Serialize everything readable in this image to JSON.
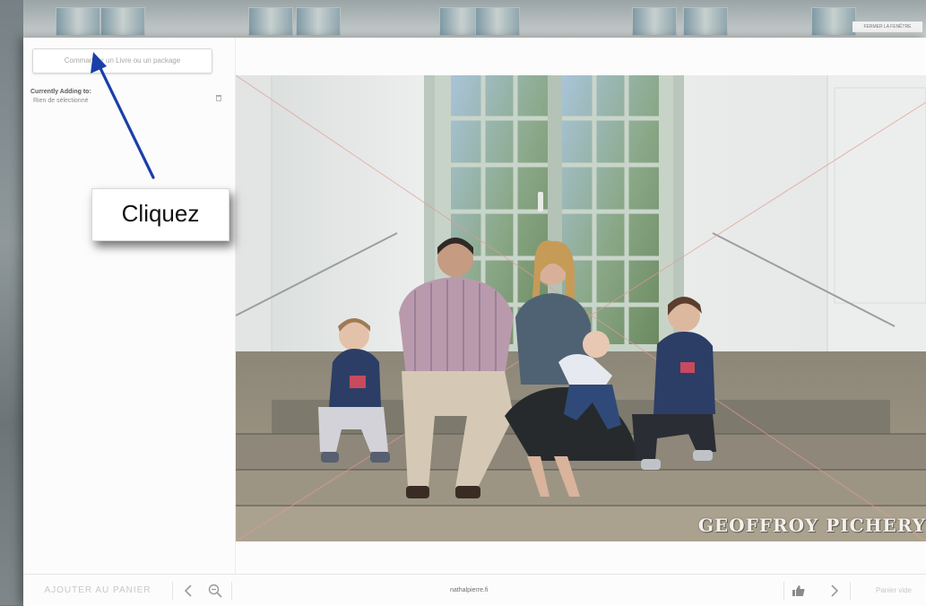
{
  "background": {
    "top_label": "FERMER LA FENÊTRE"
  },
  "sidebar": {
    "order_button_label": "Commander un Livre ou un package",
    "currently_adding_title": "Currently Adding to:",
    "currently_adding_value": "Rien de sélectionné",
    "clear_icon": "trash-icon"
  },
  "photo": {
    "watermark": "GEOFFROY PICHERY",
    "subject": "Family of five seated on stone steps in front of a white house with a green French door"
  },
  "bottom_bar": {
    "add_to_cart_label": "AJOUTER AU PANIER",
    "prev_icon": "chevron-left-icon",
    "zoom_icon": "zoom-out-icon",
    "filename": "nathalpierre.fi",
    "like_icon": "thumbs-up-icon",
    "next_icon": "chevron-right-icon",
    "cart_status": "Panier vide"
  },
  "annotation": {
    "callout_text": "Cliquez",
    "arrow_color": "#1a3fa8"
  }
}
